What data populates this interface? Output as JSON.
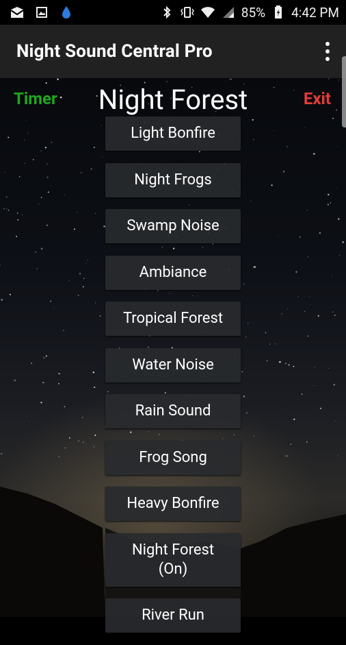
{
  "status_bar": {
    "battery": "85%",
    "time": "4:42 PM",
    "icons": [
      "mail-icon",
      "image-icon",
      "water-drop-icon",
      "bluetooth-icon",
      "vibrate-icon",
      "wifi-icon",
      "signal-icon",
      "battery-icon"
    ]
  },
  "app_bar": {
    "title": "Night Sound Central Pro",
    "menu_icon": "overflow-menu-icon"
  },
  "header": {
    "timer_label": "Timer",
    "scene_title": "Night Forest",
    "exit_label": "Exit"
  },
  "sounds": [
    {
      "label": "Light Bonfire"
    },
    {
      "label": "Night Frogs"
    },
    {
      "label": "Swamp Noise"
    },
    {
      "label": "Ambiance"
    },
    {
      "label": "Tropical Forest"
    },
    {
      "label": "Water Noise"
    },
    {
      "label": "Rain Sound"
    },
    {
      "label": "Frog Song"
    },
    {
      "label": "Heavy Bonfire"
    },
    {
      "label": "Night Forest\n(On)"
    },
    {
      "label": "River Run"
    }
  ],
  "colors": {
    "timer": "#1ea81e",
    "exit": "#e83a3a",
    "app_bar": "#212121"
  }
}
